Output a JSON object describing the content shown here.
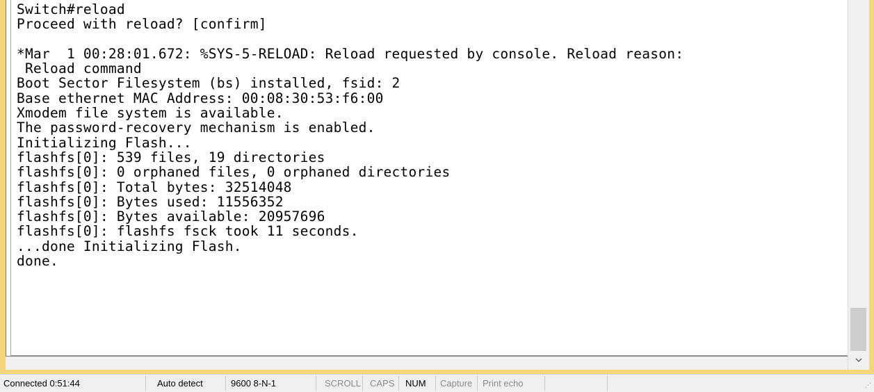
{
  "background_text": "...",
  "terminal": {
    "lines": [
      "Switch#reload",
      "Proceed with reload? [confirm]",
      "",
      "*Mar  1 00:28:01.672: %SYS-5-RELOAD: Reload requested by console. Reload reason:",
      " Reload command",
      "Boot Sector Filesystem (bs) installed, fsid: 2",
      "Base ethernet MAC Address: 00:08:30:53:f6:00",
      "Xmodem file system is available.",
      "The password-recovery mechanism is enabled.",
      "Initializing Flash...",
      "flashfs[0]: 539 files, 19 directories",
      "flashfs[0]: 0 orphaned files, 0 orphaned directories",
      "flashfs[0]: Total bytes: 32514048",
      "flashfs[0]: Bytes used: 11556352",
      "flashfs[0]: Bytes available: 20957696",
      "flashfs[0]: flashfs fsck took 11 seconds.",
      "...done Initializing Flash.",
      "done."
    ]
  },
  "scrollbar": {
    "down_icon": "chevron-down-icon"
  },
  "statusbar": {
    "connected": "Connected 0:51:44",
    "detect": "Auto detect",
    "settings": "9600 8-N-1",
    "scroll": "SCROLL",
    "caps": "CAPS",
    "num": "NUM",
    "capture": "Capture",
    "print_echo": "Print echo"
  },
  "colors": {
    "frame": "#f4d77a",
    "terminal_bg": "#ffffff",
    "statusbar_bg": "#f0f0f0"
  }
}
